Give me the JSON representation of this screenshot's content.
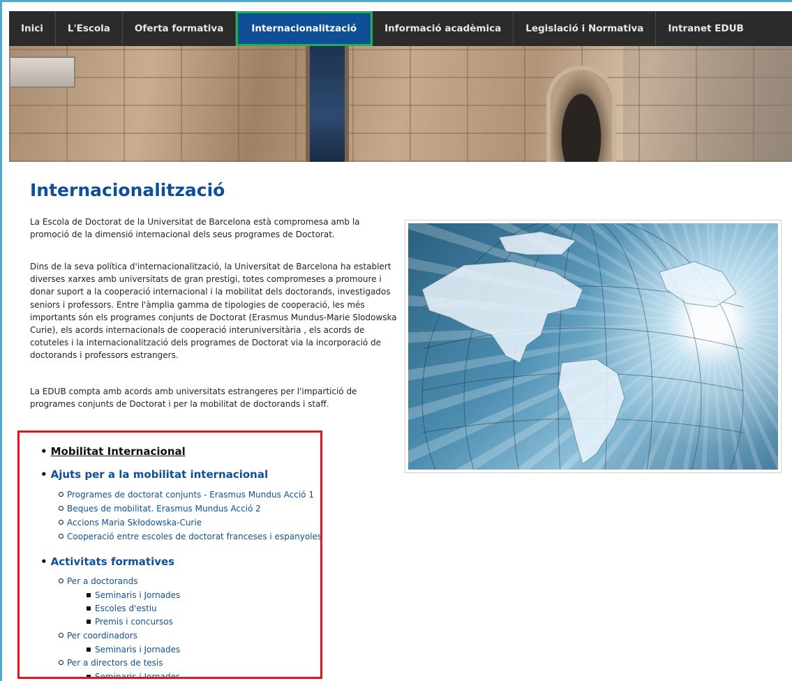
{
  "nav": {
    "items": [
      {
        "label": "Inici"
      },
      {
        "label": "L'Escola"
      },
      {
        "label": "Oferta formativa"
      },
      {
        "label": "Internacionalització"
      },
      {
        "label": "Informació acadèmica"
      },
      {
        "label": "Legislació i Normativa"
      },
      {
        "label": "Intranet EDUB"
      }
    ],
    "active_index": 3
  },
  "main": {
    "title": "Internacionalització",
    "paragraphs": [
      "La Escola de Doctorat de la Universitat de Barcelona està compromesa amb la promoció de la dimensió internacional dels seus programes de Doctorat.",
      "Dins de la seva política d'internacionalització, la Universitat de Barcelona ha establert diverses xarxes amb universitats de gran prestigi, totes compromeses a promoure i donar suport a la cooperació internacional i la mobilitat dels doctorands, investigados seniors i professors. Entre l'àmplia gamma de tipologies de cooperació, les més importants són els programes conjunts de Doctorat (Erasmus Mundus-Marie Slodowska Curie), els acords internacionals de cooperació interuniversitària , els acords de cotuteles i la internacionalització dels programes de Doctorat via la incorporació de doctorands i professors estrangers.",
      "La EDUB compta amb acords amb universitats estrangeres per l'impartició de programes conjunts de Doctorat i per la mobilitat de doctorands i staff."
    ]
  },
  "links": {
    "mobilitat": "Mobilitat Internacional",
    "ajuts": {
      "label": "Ajuts per a la mobilitat internacional",
      "items": [
        "Programes de doctorat conjunts - Erasmus Mundus Acció 1",
        "Beques de mobilitat. Erasmus Mundus Acció 2",
        "Accions Maria Skłodowska-Curie",
        "Cooperació entre escoles de doctorat franceses i espanyoles"
      ]
    },
    "activitats": {
      "label": "Activitats formatives",
      "doctorands": {
        "label": "Per a doctorands",
        "items": [
          "Seminaris i Jornades",
          "Escoles d'estiu",
          "Premis i concursos"
        ]
      },
      "coordinadors": {
        "label": "Per coordinadors",
        "items": [
          "Seminaris i Jornades"
        ]
      },
      "directors": {
        "label": "Per a directors de tesis",
        "items": [
          "Seminaris i Jornades"
        ]
      }
    }
  },
  "colors": {
    "nav_bg": "#2b2b2b",
    "active_tab": "#0f4f97",
    "active_highlight": "#22b14c",
    "link_blue": "#0f4f97",
    "list_highlight": "#e8121b",
    "frame": "#4fa9cf"
  }
}
